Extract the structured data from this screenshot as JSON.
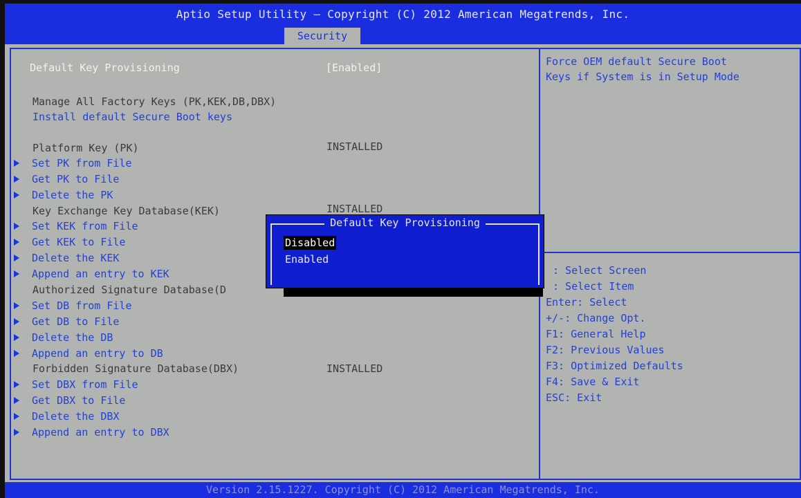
{
  "header": {
    "title": "Aptio Setup Utility – Copyright (C) 2012 American Megatrends, Inc.",
    "active_tab": "Security"
  },
  "main": {
    "default_key_provisioning": {
      "label": "Default Key Provisioning",
      "value": "[Enabled]"
    },
    "manage_keys_label": "Manage All Factory Keys (PK,KEK,DB,DBX)",
    "install_default_keys": "Install default Secure Boot keys",
    "pk": {
      "label": "Platform Key (PK)",
      "status": "INSTALLED"
    },
    "pk_items": [
      "Set PK from File",
      "Get PK to File",
      "Delete the PK"
    ],
    "kek": {
      "label": "Key Exchange Key Database(KEK)",
      "status": "INSTALLED"
    },
    "kek_items": [
      "Set KEK from File",
      "Get KEK to File",
      "Delete the KEK",
      "Append an entry to KEK"
    ],
    "db": {
      "label": "Authorized Signature Database(D"
    },
    "db_items": [
      "Set DB from File",
      "Get DB to File",
      "Delete the DB",
      "Append an entry to DB"
    ],
    "dbx": {
      "label": "Forbidden Signature Database(DBX)",
      "status": "INSTALLED"
    },
    "dbx_items": [
      "Set DBX from File",
      "Get DBX to File",
      "Delete the DBX",
      "Append an entry to DBX"
    ]
  },
  "help": {
    "line1": "Force OEM default Secure Boot",
    "line2": "Keys if System is in Setup Mode"
  },
  "keys": [
    ": Select Screen",
    ": Select Item",
    "Enter: Select",
    "+/-: Change Opt.",
    "F1: General Help",
    "F2: Previous Values",
    "F3: Optimized Defaults",
    "F4: Save & Exit",
    "ESC: Exit"
  ],
  "popup": {
    "title": "Default Key Provisioning",
    "options": [
      "Disabled",
      "Enabled"
    ],
    "selected": "Disabled"
  },
  "footer": "Version 2.15.1227. Copyright (C) 2012 American Megatrends, Inc.",
  "colors": {
    "header_blue": "#1a2ee0",
    "background_gray": "#b2b4b2",
    "link_blue": "#2341d4",
    "highlight": "#f3f3e6"
  }
}
